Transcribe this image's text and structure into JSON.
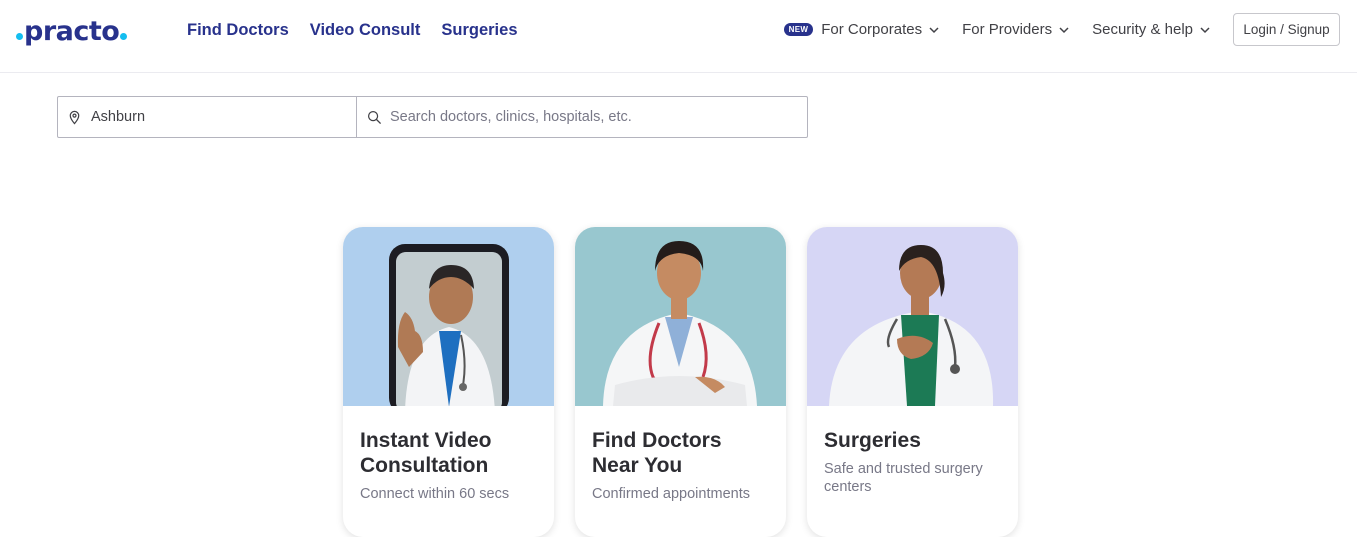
{
  "brand": {
    "logo_text": "practo",
    "colors": {
      "primary": "#28328c",
      "accent": "#14bef0"
    }
  },
  "header": {
    "main_nav": [
      "Find Doctors",
      "Video Consult",
      "Surgeries"
    ],
    "new_badge": "NEW",
    "corporates": "For Corporates",
    "providers": "For Providers",
    "security": "Security & help",
    "login": "Login / Signup"
  },
  "search": {
    "location_value": "Ashburn",
    "query_placeholder": "Search doctors, clinics, hospitals, etc."
  },
  "cards": [
    {
      "title": "Instant Video Consultation",
      "subtitle": "Connect within 60 secs",
      "bg": "#afcfee"
    },
    {
      "title": "Find Doctors Near You",
      "subtitle": "Confirmed appointments",
      "bg": "#98c7cf"
    },
    {
      "title": "Surgeries",
      "subtitle": "Safe and trusted surgery centers",
      "bg": "#d6d6f5"
    }
  ]
}
